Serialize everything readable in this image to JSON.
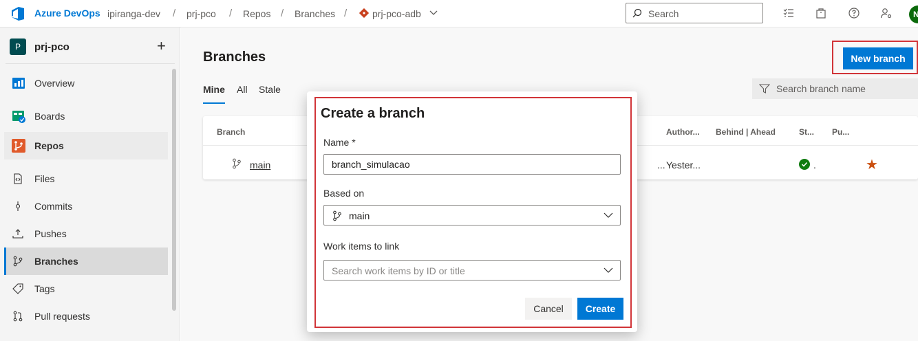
{
  "topbar": {
    "brand": "Azure DevOps",
    "breadcrumbs": [
      "ipiranga-dev",
      "prj-pco",
      "Repos",
      "Branches",
      "prj-pco-adb"
    ],
    "separator": "/",
    "search_placeholder": "Search",
    "user_initial": "N"
  },
  "sidebar": {
    "project_initial": "P",
    "project_name": "prj-pco",
    "add_symbol": "+",
    "items": [
      {
        "label": "Overview"
      },
      {
        "label": "Boards"
      },
      {
        "label": "Repos"
      }
    ],
    "sub_items": [
      {
        "label": "Files"
      },
      {
        "label": "Commits"
      },
      {
        "label": "Pushes"
      },
      {
        "label": "Branches"
      },
      {
        "label": "Tags"
      },
      {
        "label": "Pull requests"
      }
    ]
  },
  "main": {
    "title": "Branches",
    "new_branch_label": "New branch",
    "tabs": [
      "Mine",
      "All",
      "Stale"
    ],
    "filter_placeholder": "Search branch name",
    "table": {
      "headers": [
        "Branch",
        "Author...",
        "Behind | Ahead",
        "St...",
        "Pu..."
      ],
      "row": {
        "branch": "main",
        "ellipsis": "...",
        "author": "Yester...",
        "status_dot": "."
      }
    }
  },
  "dialog": {
    "title": "Create a branch",
    "name_label": "Name *",
    "name_value": "branch_simulacao",
    "based_on_label": "Based on",
    "based_on_value": "main",
    "work_items_label": "Work items to link",
    "work_items_placeholder": "Search work items by ID or title",
    "cancel_label": "Cancel",
    "create_label": "Create"
  },
  "colors": {
    "accent": "#0078d4",
    "highlight": "#d13438",
    "success": "#107c10",
    "star": "#ca5010"
  }
}
